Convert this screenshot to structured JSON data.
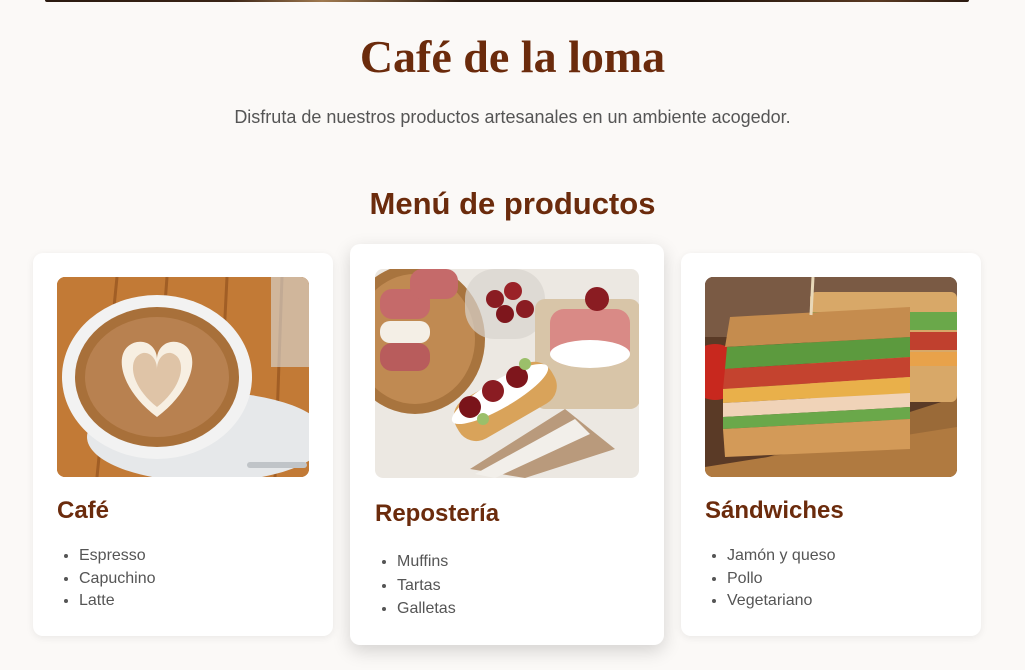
{
  "header": {
    "title": "Café de la loma",
    "subtitle": "Disfruta de nuestros productos artesanales en un ambiente acogedor."
  },
  "menu": {
    "title": "Menú de productos",
    "cards": [
      {
        "title": "Café",
        "image_icon": "latte-art-photo",
        "items": [
          "Espresso",
          "Capuchino",
          "Latte"
        ]
      },
      {
        "title": "Repostería",
        "image_icon": "pastries-photo",
        "items": [
          "Muffins",
          "Tartas",
          "Galletas"
        ]
      },
      {
        "title": "Sándwiches",
        "image_icon": "club-sandwich-photo",
        "items": [
          "Jamón y queso",
          "Pollo",
          "Vegetariano"
        ]
      }
    ]
  },
  "colors": {
    "brand": "#6b2b0c",
    "text_muted": "#555555",
    "background": "#fbf9f7",
    "card": "#ffffff"
  }
}
